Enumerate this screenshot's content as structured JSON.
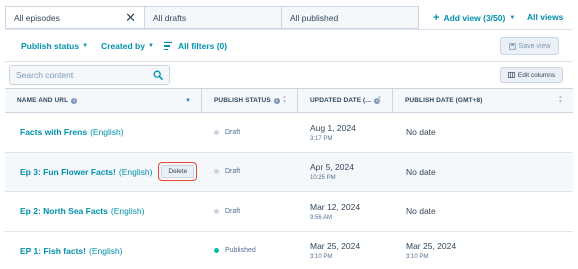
{
  "tabs": [
    {
      "label": "All episodes",
      "active": true
    },
    {
      "label": "All drafts",
      "active": false
    },
    {
      "label": "All published",
      "active": false
    }
  ],
  "add_view_label": "Add view (3/50)",
  "all_views_label": "All views",
  "filters": {
    "publish_status": "Publish status",
    "created_by": "Created by",
    "all_filters": "All filters (0)"
  },
  "save_view_label": "Save view",
  "search": {
    "placeholder": "Search content",
    "value": ""
  },
  "edit_columns_label": "Edit columns",
  "columns": [
    {
      "label": "NAME AND URL",
      "sorted": "desc"
    },
    {
      "label": "PUBLISH STATUS"
    },
    {
      "label": "UPDATED DATE (..."
    },
    {
      "label": "PUBLISH DATE (GMT+8)"
    }
  ],
  "rows": [
    {
      "name": "Facts with Frens",
      "lang": "(English)",
      "status": "Draft",
      "updated_date": "Aug 1, 2024",
      "updated_time": "3:17 PM",
      "publish_date": "No date",
      "publish_time": ""
    },
    {
      "name": "Ep 3: Fun Flower Facts!",
      "lang": "(English)",
      "status": "Draft",
      "updated_date": "Apr 5, 2024",
      "updated_time": "10:25 PM",
      "publish_date": "No date",
      "publish_time": "",
      "delete_label": "Delete"
    },
    {
      "name": "Ep 2: North Sea Facts",
      "lang": "(English)",
      "status": "Draft",
      "updated_date": "Mar 12, 2024",
      "updated_time": "9:56 AM",
      "publish_date": "No date",
      "publish_time": ""
    },
    {
      "name": "EP 1: Fish facts!",
      "lang": "(English)",
      "status": "Published",
      "updated_date": "Mar 25, 2024",
      "updated_time": "3:10 PM",
      "publish_date": "Mar 25, 2024",
      "publish_time": "3:10 PM"
    }
  ],
  "colors": {
    "link": "#0091ae",
    "delete_highlight": "#e8483b",
    "published_dot": "#00bda5",
    "draft_dot": "#cbd6e2"
  }
}
